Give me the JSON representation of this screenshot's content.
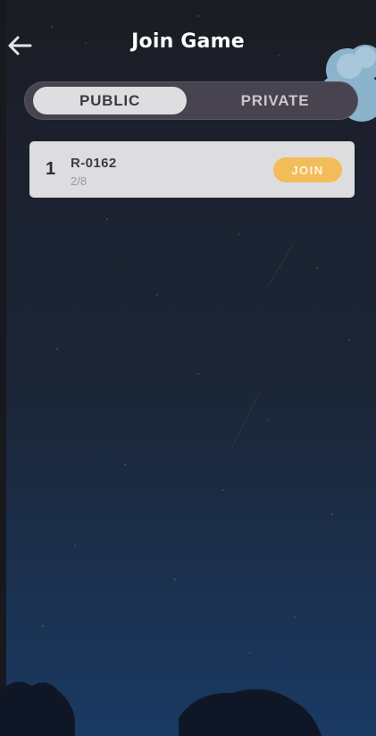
{
  "header": {
    "title": "Join Game",
    "back_icon": "arrow-left-icon"
  },
  "tabs": [
    {
      "label": "PUBLIC",
      "active": true
    },
    {
      "label": "PRIVATE",
      "active": false
    }
  ],
  "rooms": [
    {
      "index": "1",
      "name": "R-0162",
      "players": "2/8",
      "action_label": "JOIN"
    }
  ],
  "colors": {
    "accent": "#f3bc5a",
    "active_tab": "#dedde0",
    "tab_track": "#47434f",
    "card": "#dddde0"
  }
}
